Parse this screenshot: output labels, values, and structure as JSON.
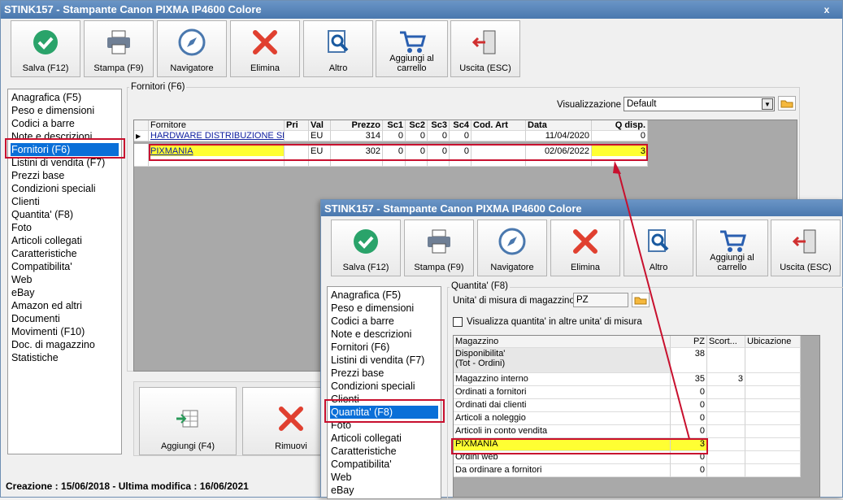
{
  "window_back": {
    "title": "STINK157 - Stampante Canon PIXMA IP4600 Colore",
    "close": "x",
    "toolbar": [
      {
        "id": "save",
        "label": "Salva (F12)"
      },
      {
        "id": "print",
        "label": "Stampa (F9)"
      },
      {
        "id": "nav",
        "label": "Navigatore"
      },
      {
        "id": "delete",
        "label": "Elimina"
      },
      {
        "id": "other",
        "label": "Altro"
      },
      {
        "id": "cart",
        "label": "Aggiungi al\ncarrello"
      },
      {
        "id": "exit",
        "label": "Uscita (ESC)"
      }
    ],
    "nav_items": [
      "Anagrafica (F5)",
      "Peso e dimensioni",
      "Codici a barre",
      "Note e descrizioni",
      "Fornitori (F6)",
      "Listini di vendita (F7)",
      "Prezzi base",
      "Condizioni speciali",
      "Clienti",
      "Quantita' (F8)",
      "Foto",
      "Articoli collegati",
      "Caratteristiche",
      "Compatibilita'",
      "Web",
      "eBay",
      "Amazon ed altri",
      "Documenti",
      "Movimenti (F10)",
      "Doc. di magazzino",
      "Statistiche"
    ],
    "nav_selected": 4,
    "group_title": "Fornitori (F6)",
    "view_label": "Visualizzazione :",
    "view_value": "Default",
    "suppliers": {
      "columns": [
        "Fornitore",
        "Pri",
        "Val",
        "Prezzo",
        "Sc1",
        "Sc2",
        "Sc3",
        "Sc4",
        "Cod. Art",
        "Data",
        "Q disp."
      ],
      "rows": [
        {
          "fornitore": "HARDWARE DISTRIBUZIONE SRL",
          "pri": "",
          "val": "EU",
          "prezzo": "314",
          "sc1": "0",
          "sc2": "0",
          "sc3": "0",
          "sc4": "0",
          "codart": "",
          "data": "11/04/2020",
          "qdisp": "0"
        },
        {
          "fornitore": "PIXMANIA",
          "pri": "",
          "val": "EU",
          "prezzo": "302",
          "sc1": "0",
          "sc2": "0",
          "sc3": "0",
          "sc4": "0",
          "codart": "",
          "data": "02/06/2022",
          "qdisp": "3"
        }
      ]
    },
    "bottom_buttons": [
      {
        "id": "add",
        "label": "Aggiungi (F4)"
      },
      {
        "id": "remove",
        "label": "Rimuovi"
      }
    ],
    "status": "Creazione : 15/06/2018 - Ultima modifica : 16/06/2021"
  },
  "window_front": {
    "title": "STINK157 - Stampante Canon PIXMA IP4600 Colore",
    "toolbar": [
      {
        "id": "save",
        "label": "Salva (F12)"
      },
      {
        "id": "print",
        "label": "Stampa (F9)"
      },
      {
        "id": "nav",
        "label": "Navigatore"
      },
      {
        "id": "delete",
        "label": "Elimina"
      },
      {
        "id": "other",
        "label": "Altro"
      },
      {
        "id": "cart",
        "label": "Aggiungi al\ncarrello"
      },
      {
        "id": "exit",
        "label": "Uscita (ESC)"
      }
    ],
    "nav_items": [
      "Anagrafica (F5)",
      "Peso e dimensioni",
      "Codici a barre",
      "Note e descrizioni",
      "Fornitori (F6)",
      "Listini di vendita (F7)",
      "Prezzi base",
      "Condizioni speciali",
      "Clienti",
      "Quantita' (F8)",
      "Foto",
      "Articoli collegati",
      "Caratteristiche",
      "Compatibilita'",
      "Web",
      "eBay"
    ],
    "nav_selected": 9,
    "group_title": "Quantita' (F8)",
    "unit_label": "Unita' di misura di magazzino :",
    "unit_value": "PZ",
    "checkbox_label": "Visualizza quantita' in altre unita' di misura",
    "qty": {
      "columns": [
        "Magazzino",
        "PZ",
        "Scort...",
        "Ubicazione"
      ],
      "rows": [
        {
          "name": "Disponibilita'\n(Tot - Ordini)",
          "pz": "38",
          "scort": "",
          "ubic": ""
        },
        {
          "name": "Magazzino interno",
          "pz": "35",
          "scort": "3",
          "ubic": ""
        },
        {
          "name": "Ordinati a fornitori",
          "pz": "0",
          "scort": "",
          "ubic": ""
        },
        {
          "name": "Ordinati dai clienti",
          "pz": "0",
          "scort": "",
          "ubic": ""
        },
        {
          "name": "Articoli a noleggio",
          "pz": "0",
          "scort": "",
          "ubic": ""
        },
        {
          "name": "Articoli in conto vendita",
          "pz": "0",
          "scort": "",
          "ubic": ""
        },
        {
          "name": "PIXMANIA",
          "pz": "3",
          "scort": "",
          "ubic": ""
        },
        {
          "name": "Ordini web",
          "pz": "0",
          "scort": "",
          "ubic": ""
        },
        {
          "name": "Da ordinare a fornitori",
          "pz": "0",
          "scort": "",
          "ubic": ""
        }
      ]
    }
  },
  "colors": {
    "highlight": "#ffff33",
    "annotation": "#c8102e",
    "selection": "#0a6fd8",
    "title": "#4a78ae"
  }
}
